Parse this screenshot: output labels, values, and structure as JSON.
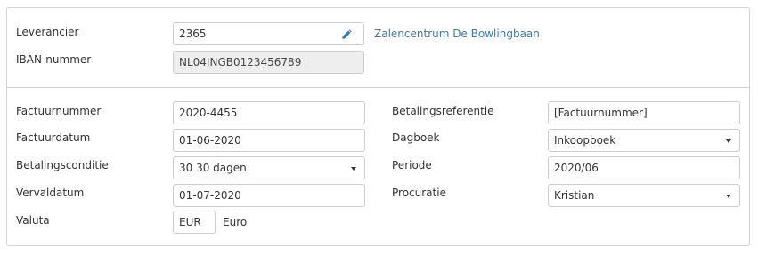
{
  "supplier": {
    "leverancier_label": "Leverancier",
    "leverancier_value": "2365",
    "supplier_name": "Zalencentrum De Bowlingbaan",
    "iban_label": "IBAN-nummer",
    "iban_value": "NL04INGB0123456789",
    "edit_icon": "pencil-icon"
  },
  "invoice": {
    "factuurnummer_label": "Factuurnummer",
    "factuurnummer_value": "2020-4455",
    "factuurdatum_label": "Factuurdatum",
    "factuurdatum_value": "01-06-2020",
    "betalingsconditie_label": "Betalingsconditie",
    "betalingsconditie_value": "30 30 dagen",
    "vervaldatum_label": "Vervaldatum",
    "vervaldatum_value": "01-07-2020",
    "valuta_label": "Valuta",
    "valuta_value": "EUR",
    "valuta_name": "Euro",
    "betalingsreferentie_label": "Betalingsreferentie",
    "betalingsreferentie_value": "[Factuurnummer]",
    "dagboek_label": "Dagboek",
    "dagboek_value": "Inkoopboek",
    "periode_label": "Periode",
    "periode_value": "2020/06",
    "procuratie_label": "Procuratie",
    "procuratie_value": "Kristian"
  },
  "colors": {
    "link": "#337ab7",
    "border": "#cccccc",
    "disabled_bg": "#eeeeee"
  }
}
